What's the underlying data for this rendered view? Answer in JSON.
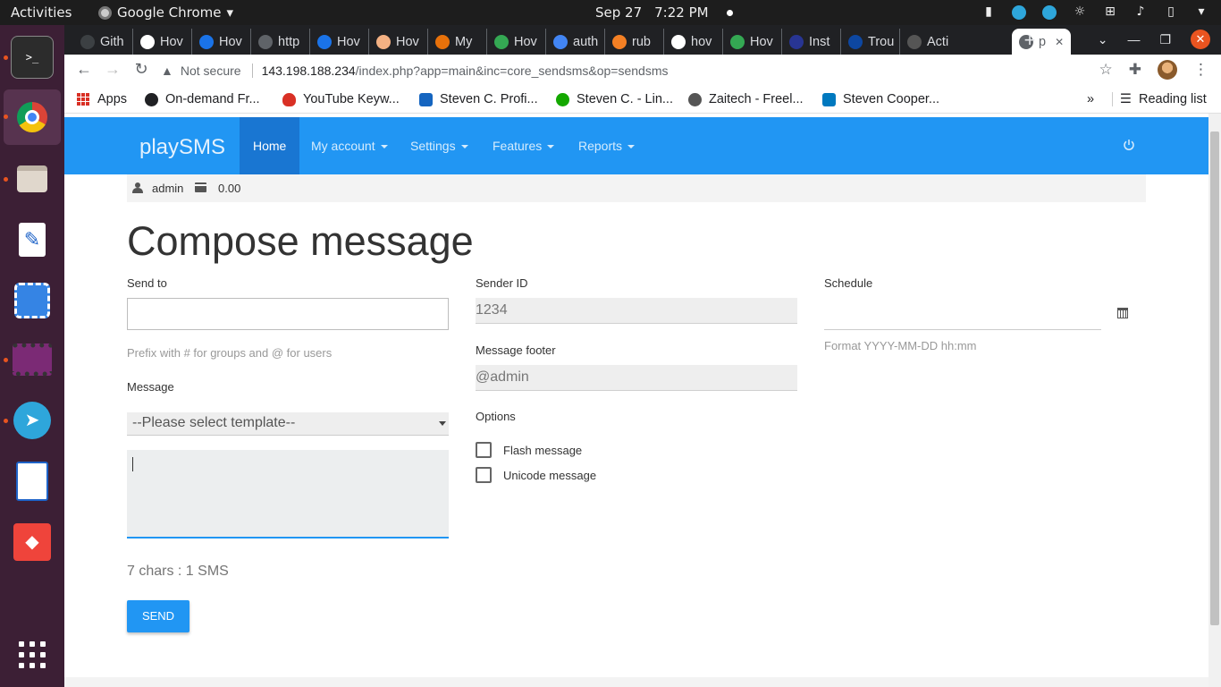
{
  "os": {
    "activities": "Activities",
    "app_name": "Google Chrome",
    "date": "Sep 27",
    "time": "7:22 PM"
  },
  "tabs": [
    {
      "label": "Gith",
      "color": "#3c4043"
    },
    {
      "label": "Hov",
      "color": "#ffffff"
    },
    {
      "label": "Hov",
      "color": "#1a73e8"
    },
    {
      "label": "http",
      "color": "#5f6368"
    },
    {
      "label": "Hov",
      "color": "#1a73e8"
    },
    {
      "label": "Hov",
      "color": "#f4b183"
    },
    {
      "label": "My",
      "color": "#e8710a"
    },
    {
      "label": "Hov",
      "color": "#34a853"
    },
    {
      "label": "auth",
      "color": "#4285f4"
    },
    {
      "label": "rub",
      "color": "#f48024"
    },
    {
      "label": "hov",
      "color": "#ffffff"
    },
    {
      "label": "Hov",
      "color": "#34a853"
    },
    {
      "label": "Inst",
      "color": "#283593"
    },
    {
      "label": "Trou",
      "color": "#0d47a1"
    },
    {
      "label": "Acti",
      "color": "#555555"
    },
    {
      "label": "p",
      "color": "#5f6368",
      "active": true
    }
  ],
  "address": {
    "warning": "Not secure",
    "host": "143.198.188.234",
    "path": "/index.php?app=main&inc=core_sendsms&op=sendsms"
  },
  "bookmarks": [
    {
      "label": "Apps"
    },
    {
      "label": "On-demand Fr...",
      "color": "#202124"
    },
    {
      "label": "YouTube Keyw...",
      "color": "#d93025"
    },
    {
      "label": "Steven C. Profi...",
      "color": "#1565c0"
    },
    {
      "label": "Steven C. - Lin...",
      "color": "#14a800"
    },
    {
      "label": "Zaitech - Freel...",
      "color": "#555555"
    },
    {
      "label": "Steven Cooper...",
      "color": "#0079bf"
    }
  ],
  "reading_list": "Reading list",
  "more_bookmarks": "»",
  "app": {
    "brand": "playSMS",
    "nav": [
      {
        "label": "Home",
        "active": true
      },
      {
        "label": "My account"
      },
      {
        "label": "Settings"
      },
      {
        "label": "Features"
      },
      {
        "label": "Reports"
      }
    ],
    "user": "admin",
    "credit": "0.00"
  },
  "form": {
    "title": "Compose message",
    "send_to_label": "Send to",
    "send_to_value": "",
    "send_to_help": "Prefix with # for groups and @ for users",
    "message_label": "Message",
    "template_selected": "--Please select template--",
    "message_value": "",
    "counter": "7 chars : 1 SMS",
    "send_label": "SEND",
    "sender_id_label": "Sender ID",
    "sender_id_value": "1234",
    "footer_label": "Message footer",
    "footer_value": "@admin",
    "options_label": "Options",
    "flash_label": "Flash message",
    "unicode_label": "Unicode message",
    "schedule_label": "Schedule",
    "schedule_value": "",
    "schedule_help": "Format YYYY-MM-DD hh:mm"
  },
  "colors": {
    "primary": "#2196f3",
    "primary_dark": "#1976d2"
  }
}
